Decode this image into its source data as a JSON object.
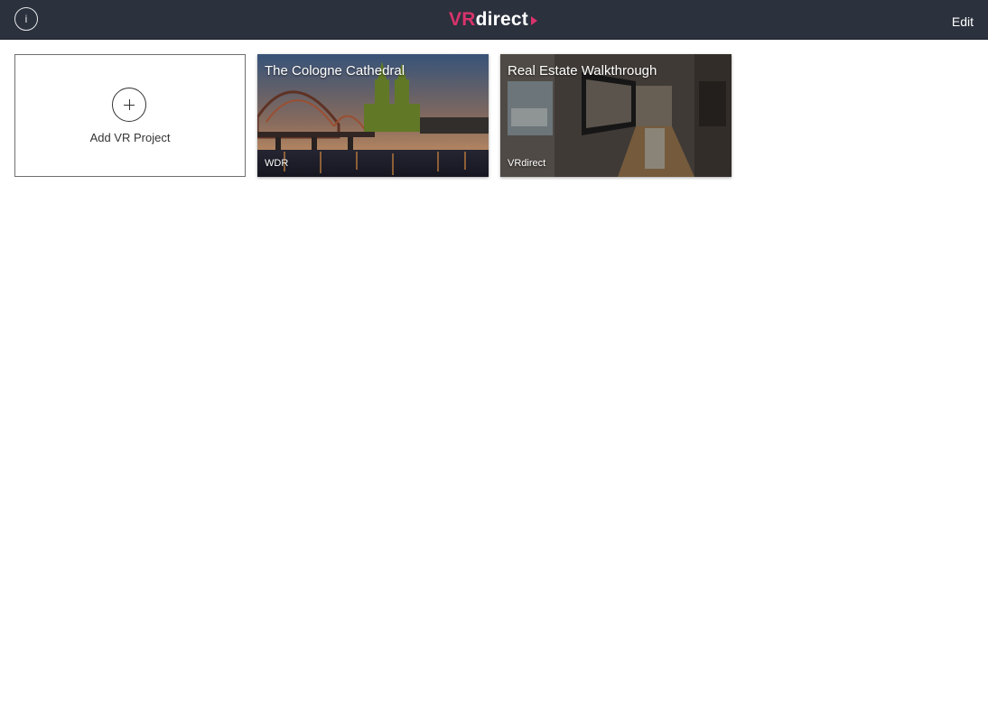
{
  "header": {
    "info_icon": "info-icon",
    "info_label": "i",
    "logo_vr": "VR",
    "logo_direct": "direct",
    "edit_label": "Edit",
    "brand_color": "#d9336b",
    "bar_color": "#2b313d"
  },
  "projects": {
    "add_label": "Add VR Project",
    "add_icon": "plus-icon",
    "items": [
      {
        "title": "The Cologne Cathedral",
        "author": "WDR"
      },
      {
        "title": "Real Estate Walkthrough",
        "author": "VRdirect"
      }
    ]
  }
}
